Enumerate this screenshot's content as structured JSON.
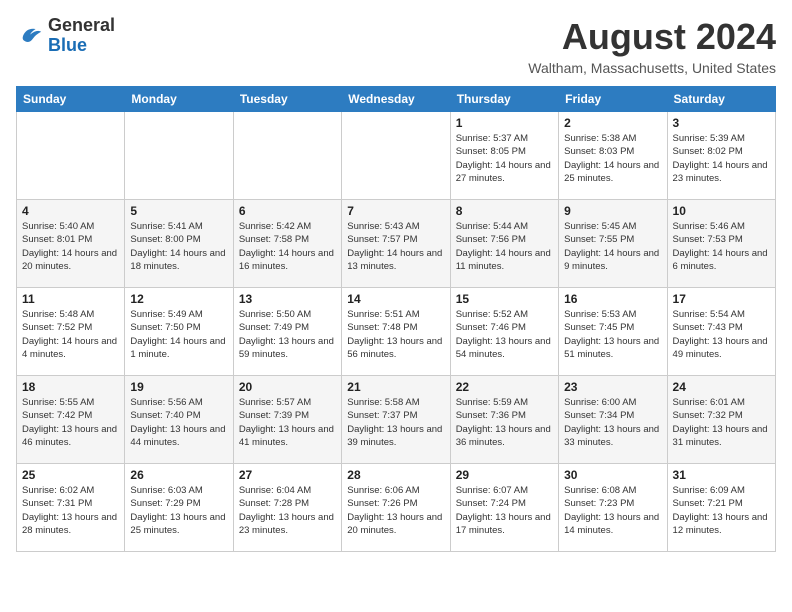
{
  "header": {
    "logo_line1": "General",
    "logo_line2": "Blue",
    "title": "August 2024",
    "subtitle": "Waltham, Massachusetts, United States"
  },
  "days_of_week": [
    "Sunday",
    "Monday",
    "Tuesday",
    "Wednesday",
    "Thursday",
    "Friday",
    "Saturday"
  ],
  "weeks": [
    [
      {
        "date": "",
        "sunrise": "",
        "sunset": "",
        "daylight": ""
      },
      {
        "date": "",
        "sunrise": "",
        "sunset": "",
        "daylight": ""
      },
      {
        "date": "",
        "sunrise": "",
        "sunset": "",
        "daylight": ""
      },
      {
        "date": "",
        "sunrise": "",
        "sunset": "",
        "daylight": ""
      },
      {
        "date": "1",
        "sunrise": "Sunrise: 5:37 AM",
        "sunset": "Sunset: 8:05 PM",
        "daylight": "Daylight: 14 hours and 27 minutes."
      },
      {
        "date": "2",
        "sunrise": "Sunrise: 5:38 AM",
        "sunset": "Sunset: 8:03 PM",
        "daylight": "Daylight: 14 hours and 25 minutes."
      },
      {
        "date": "3",
        "sunrise": "Sunrise: 5:39 AM",
        "sunset": "Sunset: 8:02 PM",
        "daylight": "Daylight: 14 hours and 23 minutes."
      }
    ],
    [
      {
        "date": "4",
        "sunrise": "Sunrise: 5:40 AM",
        "sunset": "Sunset: 8:01 PM",
        "daylight": "Daylight: 14 hours and 20 minutes."
      },
      {
        "date": "5",
        "sunrise": "Sunrise: 5:41 AM",
        "sunset": "Sunset: 8:00 PM",
        "daylight": "Daylight: 14 hours and 18 minutes."
      },
      {
        "date": "6",
        "sunrise": "Sunrise: 5:42 AM",
        "sunset": "Sunset: 7:58 PM",
        "daylight": "Daylight: 14 hours and 16 minutes."
      },
      {
        "date": "7",
        "sunrise": "Sunrise: 5:43 AM",
        "sunset": "Sunset: 7:57 PM",
        "daylight": "Daylight: 14 hours and 13 minutes."
      },
      {
        "date": "8",
        "sunrise": "Sunrise: 5:44 AM",
        "sunset": "Sunset: 7:56 PM",
        "daylight": "Daylight: 14 hours and 11 minutes."
      },
      {
        "date": "9",
        "sunrise": "Sunrise: 5:45 AM",
        "sunset": "Sunset: 7:55 PM",
        "daylight": "Daylight: 14 hours and 9 minutes."
      },
      {
        "date": "10",
        "sunrise": "Sunrise: 5:46 AM",
        "sunset": "Sunset: 7:53 PM",
        "daylight": "Daylight: 14 hours and 6 minutes."
      }
    ],
    [
      {
        "date": "11",
        "sunrise": "Sunrise: 5:48 AM",
        "sunset": "Sunset: 7:52 PM",
        "daylight": "Daylight: 14 hours and 4 minutes."
      },
      {
        "date": "12",
        "sunrise": "Sunrise: 5:49 AM",
        "sunset": "Sunset: 7:50 PM",
        "daylight": "Daylight: 14 hours and 1 minute."
      },
      {
        "date": "13",
        "sunrise": "Sunrise: 5:50 AM",
        "sunset": "Sunset: 7:49 PM",
        "daylight": "Daylight: 13 hours and 59 minutes."
      },
      {
        "date": "14",
        "sunrise": "Sunrise: 5:51 AM",
        "sunset": "Sunset: 7:48 PM",
        "daylight": "Daylight: 13 hours and 56 minutes."
      },
      {
        "date": "15",
        "sunrise": "Sunrise: 5:52 AM",
        "sunset": "Sunset: 7:46 PM",
        "daylight": "Daylight: 13 hours and 54 minutes."
      },
      {
        "date": "16",
        "sunrise": "Sunrise: 5:53 AM",
        "sunset": "Sunset: 7:45 PM",
        "daylight": "Daylight: 13 hours and 51 minutes."
      },
      {
        "date": "17",
        "sunrise": "Sunrise: 5:54 AM",
        "sunset": "Sunset: 7:43 PM",
        "daylight": "Daylight: 13 hours and 49 minutes."
      }
    ],
    [
      {
        "date": "18",
        "sunrise": "Sunrise: 5:55 AM",
        "sunset": "Sunset: 7:42 PM",
        "daylight": "Daylight: 13 hours and 46 minutes."
      },
      {
        "date": "19",
        "sunrise": "Sunrise: 5:56 AM",
        "sunset": "Sunset: 7:40 PM",
        "daylight": "Daylight: 13 hours and 44 minutes."
      },
      {
        "date": "20",
        "sunrise": "Sunrise: 5:57 AM",
        "sunset": "Sunset: 7:39 PM",
        "daylight": "Daylight: 13 hours and 41 minutes."
      },
      {
        "date": "21",
        "sunrise": "Sunrise: 5:58 AM",
        "sunset": "Sunset: 7:37 PM",
        "daylight": "Daylight: 13 hours and 39 minutes."
      },
      {
        "date": "22",
        "sunrise": "Sunrise: 5:59 AM",
        "sunset": "Sunset: 7:36 PM",
        "daylight": "Daylight: 13 hours and 36 minutes."
      },
      {
        "date": "23",
        "sunrise": "Sunrise: 6:00 AM",
        "sunset": "Sunset: 7:34 PM",
        "daylight": "Daylight: 13 hours and 33 minutes."
      },
      {
        "date": "24",
        "sunrise": "Sunrise: 6:01 AM",
        "sunset": "Sunset: 7:32 PM",
        "daylight": "Daylight: 13 hours and 31 minutes."
      }
    ],
    [
      {
        "date": "25",
        "sunrise": "Sunrise: 6:02 AM",
        "sunset": "Sunset: 7:31 PM",
        "daylight": "Daylight: 13 hours and 28 minutes."
      },
      {
        "date": "26",
        "sunrise": "Sunrise: 6:03 AM",
        "sunset": "Sunset: 7:29 PM",
        "daylight": "Daylight: 13 hours and 25 minutes."
      },
      {
        "date": "27",
        "sunrise": "Sunrise: 6:04 AM",
        "sunset": "Sunset: 7:28 PM",
        "daylight": "Daylight: 13 hours and 23 minutes."
      },
      {
        "date": "28",
        "sunrise": "Sunrise: 6:06 AM",
        "sunset": "Sunset: 7:26 PM",
        "daylight": "Daylight: 13 hours and 20 minutes."
      },
      {
        "date": "29",
        "sunrise": "Sunrise: 6:07 AM",
        "sunset": "Sunset: 7:24 PM",
        "daylight": "Daylight: 13 hours and 17 minutes."
      },
      {
        "date": "30",
        "sunrise": "Sunrise: 6:08 AM",
        "sunset": "Sunset: 7:23 PM",
        "daylight": "Daylight: 13 hours and 14 minutes."
      },
      {
        "date": "31",
        "sunrise": "Sunrise: 6:09 AM",
        "sunset": "Sunset: 7:21 PM",
        "daylight": "Daylight: 13 hours and 12 minutes."
      }
    ]
  ]
}
